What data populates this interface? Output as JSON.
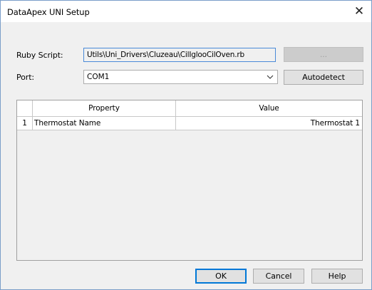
{
  "window": {
    "title": "DataApex UNI Setup",
    "close_glyph": "✕"
  },
  "script": {
    "label": "Ruby Script:",
    "value": "Utils\\Uni_Drivers\\Cluzeau\\CilIglooCilOven.rb",
    "browse_label": "..."
  },
  "port": {
    "label": "Port:",
    "selected": "COM1",
    "autodetect_label": "Autodetect"
  },
  "grid": {
    "columns": [
      "Property",
      "Value"
    ],
    "rows": [
      {
        "index": "1",
        "property": "Thermostat Name",
        "value": "Thermostat 1"
      }
    ]
  },
  "footer": {
    "ok_label": "OK",
    "cancel_label": "Cancel",
    "help_label": "Help"
  },
  "colors": {
    "accent": "#0078d7",
    "field_border": "#4a8ad8"
  }
}
